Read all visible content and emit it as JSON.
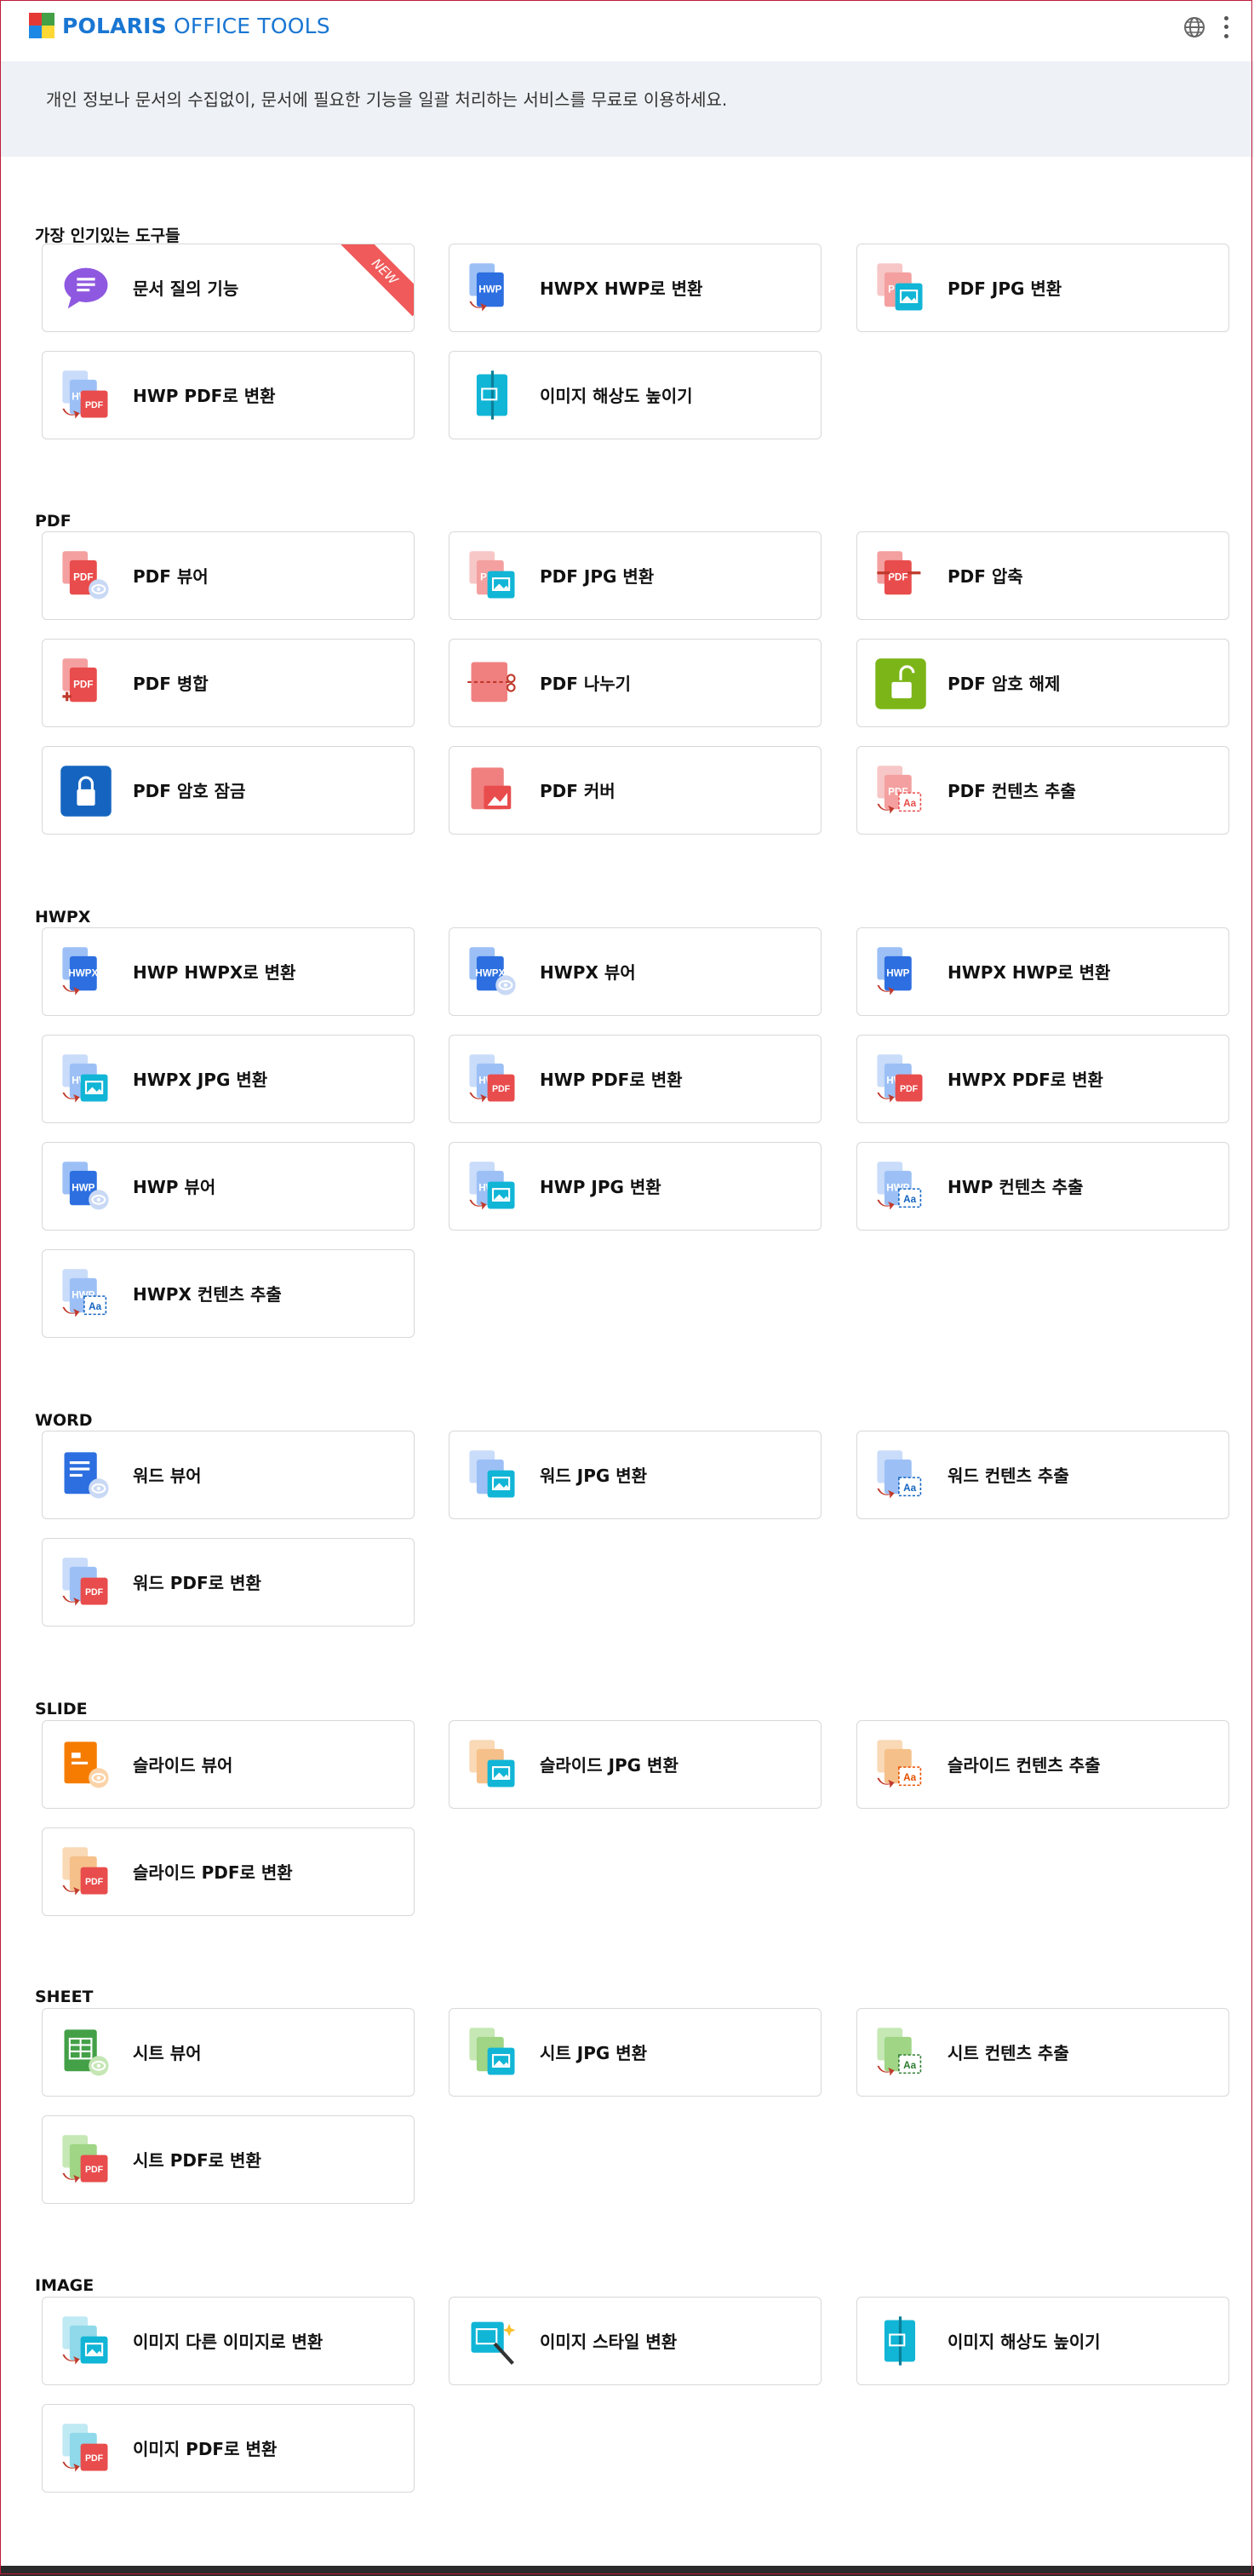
{
  "header": {
    "logo_bold": "POLARIS",
    "logo_rest": " OFFICE TOOLS",
    "globe_icon": "globe-icon",
    "menu_icon": "more-vertical-icon"
  },
  "banner": {
    "text": "개인 정보나 문서의 수집없이, 문서에 필요한 기능을 일괄 처리하는 서비스를 무료로 이용하세요."
  },
  "sections": [
    {
      "title": "가장 인기있는 도구들",
      "tools": [
        {
          "label": "문서 질의 기능",
          "icon": "chat-icon",
          "badge": "NEW"
        },
        {
          "label": "HWPX HWP로 변환",
          "icon": "hwpx-to-hwp-icon"
        },
        {
          "label": "PDF JPG 변환",
          "icon": "pdf-to-jpg-icon"
        },
        {
          "label": "HWP PDF로 변환",
          "icon": "hwp-to-pdf-icon"
        },
        {
          "label": "이미지 해상도 높이기",
          "icon": "image-upscale-icon"
        }
      ]
    },
    {
      "title": "PDF",
      "tools": [
        {
          "label": "PDF 뷰어",
          "icon": "pdf-viewer-icon"
        },
        {
          "label": "PDF JPG 변환",
          "icon": "pdf-to-jpg-icon"
        },
        {
          "label": "PDF 압축",
          "icon": "pdf-compress-icon"
        },
        {
          "label": "PDF 병합",
          "icon": "pdf-merge-icon"
        },
        {
          "label": "PDF 나누기",
          "icon": "pdf-split-icon"
        },
        {
          "label": "PDF 암호 해제",
          "icon": "unlock-icon"
        },
        {
          "label": "PDF 암호 잠금",
          "icon": "lock-icon"
        },
        {
          "label": "PDF 커버",
          "icon": "pdf-cover-icon"
        },
        {
          "label": "PDF 컨텐츠 추출",
          "icon": "pdf-extract-icon"
        }
      ]
    },
    {
      "title": "HWPX",
      "tools": [
        {
          "label": "HWP HWPX로 변환",
          "icon": "hwp-to-hwpx-icon"
        },
        {
          "label": "HWPX 뷰어",
          "icon": "hwpx-viewer-icon"
        },
        {
          "label": "HWPX HWP로 변환",
          "icon": "hwpx-to-hwp-icon"
        },
        {
          "label": "HWPX JPG 변환",
          "icon": "hwpx-to-jpg-icon"
        },
        {
          "label": "HWP PDF로 변환",
          "icon": "hwp-to-pdf-icon"
        },
        {
          "label": "HWPX PDF로 변환",
          "icon": "hwpx-to-pdf-icon"
        },
        {
          "label": "HWP 뷰어",
          "icon": "hwp-viewer-icon"
        },
        {
          "label": "HWP JPG 변환",
          "icon": "hwp-to-jpg-icon"
        },
        {
          "label": "HWP 컨텐츠 추출",
          "icon": "hwp-extract-icon"
        },
        {
          "label": "HWPX 컨텐츠 추출",
          "icon": "hwpx-extract-icon"
        }
      ]
    },
    {
      "title": "WORD",
      "tools": [
        {
          "label": "워드 뷰어",
          "icon": "word-viewer-icon"
        },
        {
          "label": "워드 JPG 변환",
          "icon": "word-to-jpg-icon"
        },
        {
          "label": "워드 컨텐츠 추출",
          "icon": "word-extract-icon"
        },
        {
          "label": "워드 PDF로 변환",
          "icon": "word-to-pdf-icon"
        }
      ]
    },
    {
      "title": "SLIDE",
      "tools": [
        {
          "label": "슬라이드 뷰어",
          "icon": "slide-viewer-icon"
        },
        {
          "label": "슬라이드 JPG 변환",
          "icon": "slide-to-jpg-icon"
        },
        {
          "label": "슬라이드 컨텐츠 추출",
          "icon": "slide-extract-icon"
        },
        {
          "label": "슬라이드 PDF로 변환",
          "icon": "slide-to-pdf-icon"
        }
      ]
    },
    {
      "title": "SHEET",
      "tools": [
        {
          "label": "시트 뷰어",
          "icon": "sheet-viewer-icon"
        },
        {
          "label": "시트 JPG 변환",
          "icon": "sheet-to-jpg-icon"
        },
        {
          "label": "시트 컨텐츠 추출",
          "icon": "sheet-extract-icon"
        },
        {
          "label": "시트 PDF로 변환",
          "icon": "sheet-to-pdf-icon"
        }
      ]
    },
    {
      "title": "IMAGE",
      "tools": [
        {
          "label": "이미지 다른 이미지로 변환",
          "icon": "image-convert-icon"
        },
        {
          "label": "이미지 스타일 변환",
          "icon": "image-style-icon"
        },
        {
          "label": "이미지 해상도 높이기",
          "icon": "image-upscale-icon"
        },
        {
          "label": "이미지 PDF로 변환",
          "icon": "image-to-pdf-icon"
        }
      ]
    }
  ]
}
